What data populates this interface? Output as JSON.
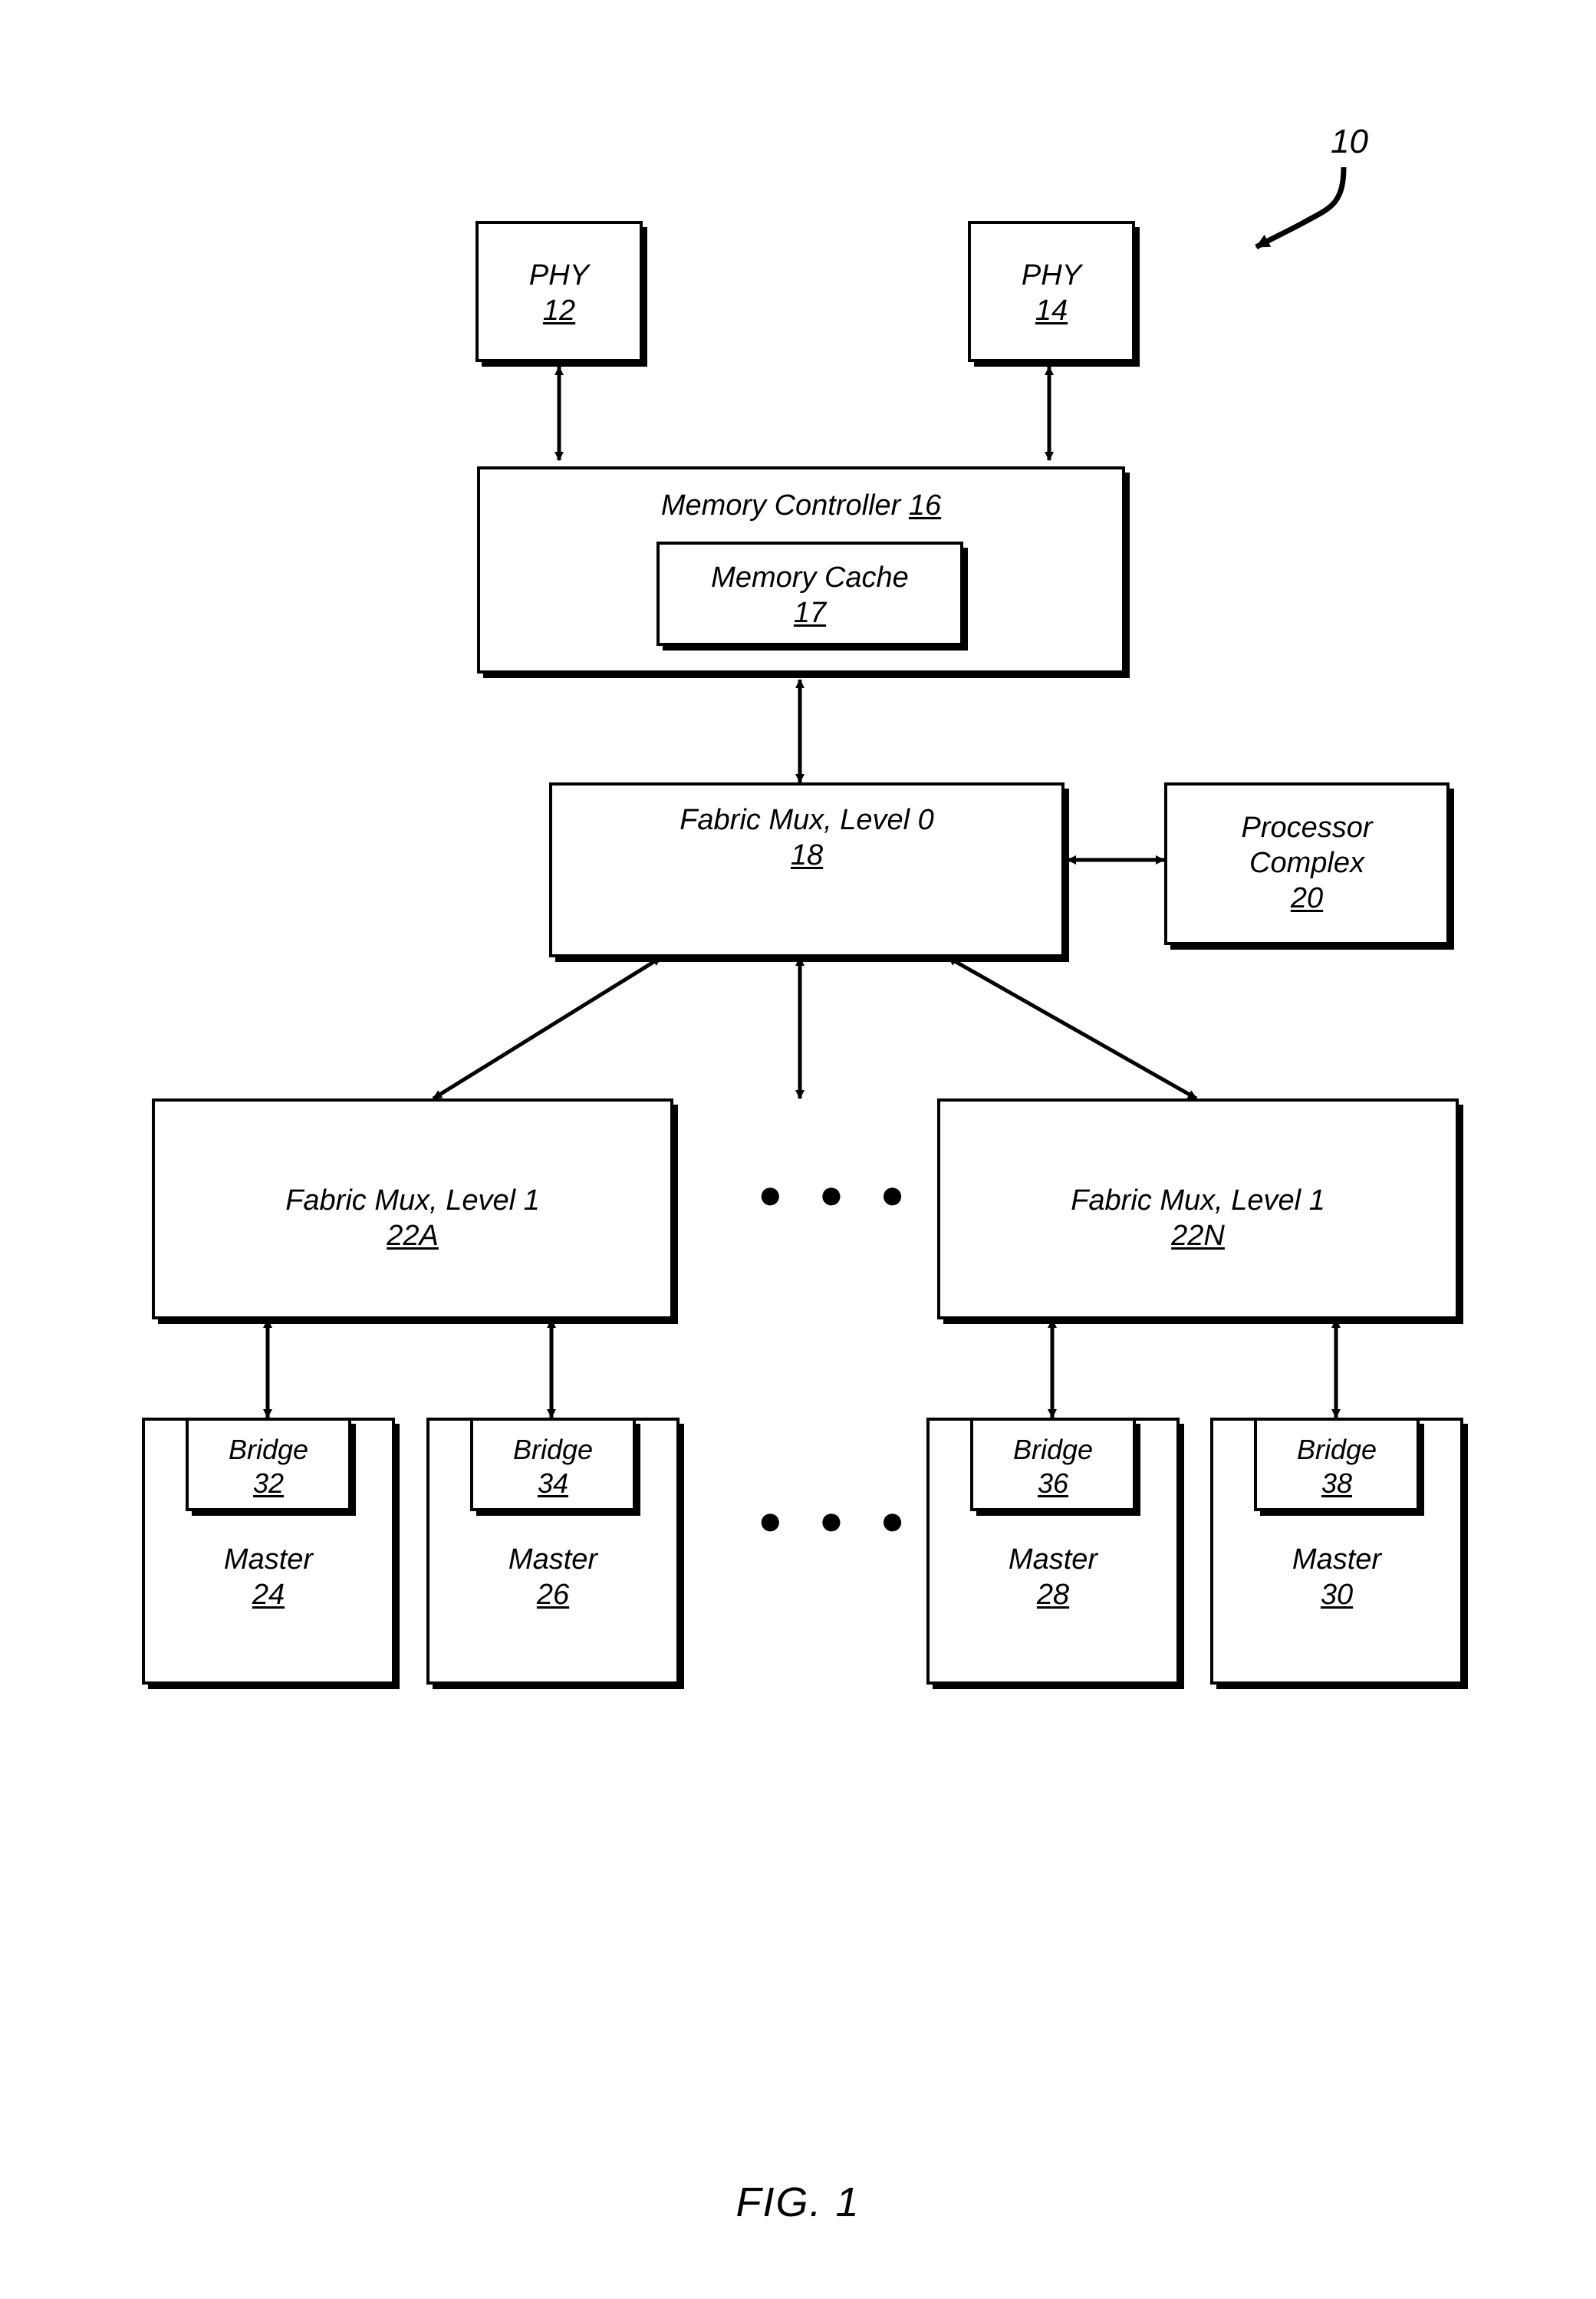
{
  "figure": {
    "caption": "FIG. 1",
    "system_reference": "10"
  },
  "blocks": {
    "phy_left": {
      "title": "PHY",
      "number": "12"
    },
    "phy_right": {
      "title": "PHY",
      "number": "14"
    },
    "memory_controller": {
      "title": "Memory Controller",
      "number": "16",
      "inline_number": true
    },
    "memory_cache": {
      "title": "Memory Cache",
      "number": "17"
    },
    "fabric_mux_level0": {
      "title": "Fabric Mux, Level 0",
      "number": "18"
    },
    "processor_complex": {
      "title": "Processor\nComplex",
      "number": "20"
    },
    "fabric_mux_level1_a": {
      "title": "Fabric Mux, Level 1",
      "number": "22A"
    },
    "fabric_mux_level1_n": {
      "title": "Fabric Mux, Level 1",
      "number": "22N"
    },
    "bridge_32": {
      "title": "Bridge",
      "number": "32"
    },
    "bridge_34": {
      "title": "Bridge",
      "number": "34"
    },
    "bridge_36": {
      "title": "Bridge",
      "number": "36"
    },
    "bridge_38": {
      "title": "Bridge",
      "number": "38"
    },
    "master_24": {
      "title": "Master",
      "number": "24"
    },
    "master_26": {
      "title": "Master",
      "number": "26"
    },
    "master_28": {
      "title": "Master",
      "number": "28"
    },
    "master_30": {
      "title": "Master",
      "number": "30"
    }
  },
  "ellipses": {
    "mux_row": "● ● ●",
    "master_row": "● ● ●"
  }
}
